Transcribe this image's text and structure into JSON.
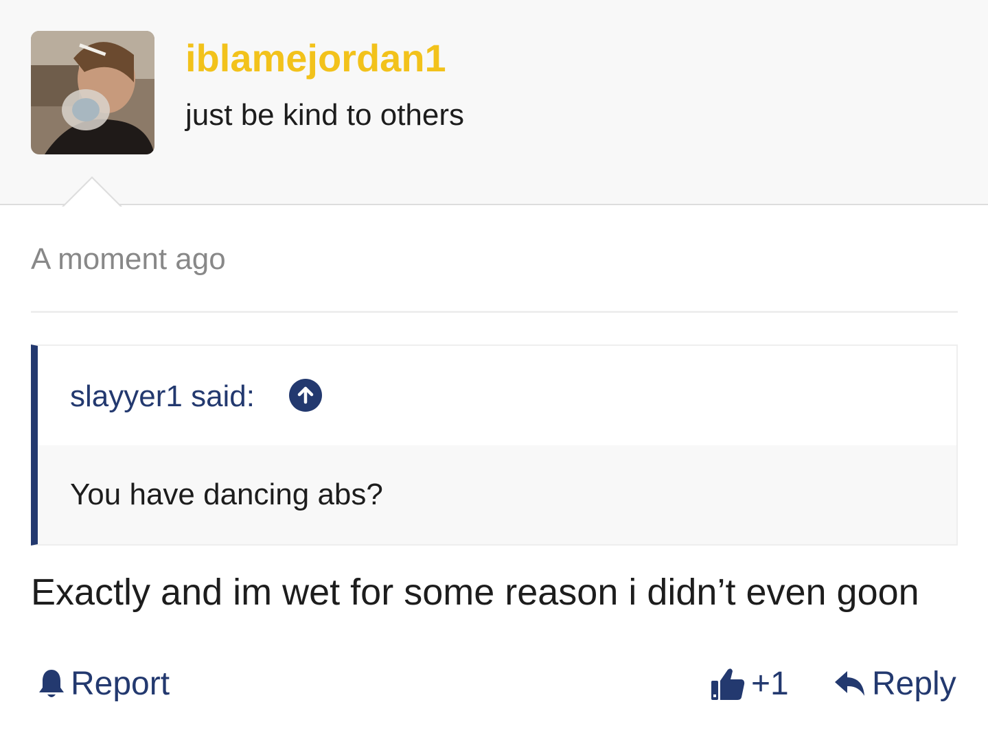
{
  "post": {
    "username": "iblamejordan1",
    "user_title": "just be kind to others",
    "username_color": "#f2c21b",
    "timestamp": "A moment ago"
  },
  "quote": {
    "author": "slayyer1 said:",
    "text": "You have dancing abs?",
    "jump_icon": "arrow-up-circle-icon",
    "accent_color": "#23396f"
  },
  "message": "Exactly and im wet for some reason i didn’t even goon",
  "actions": {
    "report_label": "Report",
    "report_icon": "bell-icon",
    "like_label": "+1",
    "like_icon": "thumbs-up-icon",
    "reply_label": "Reply",
    "reply_icon": "reply-arrow-icon"
  }
}
